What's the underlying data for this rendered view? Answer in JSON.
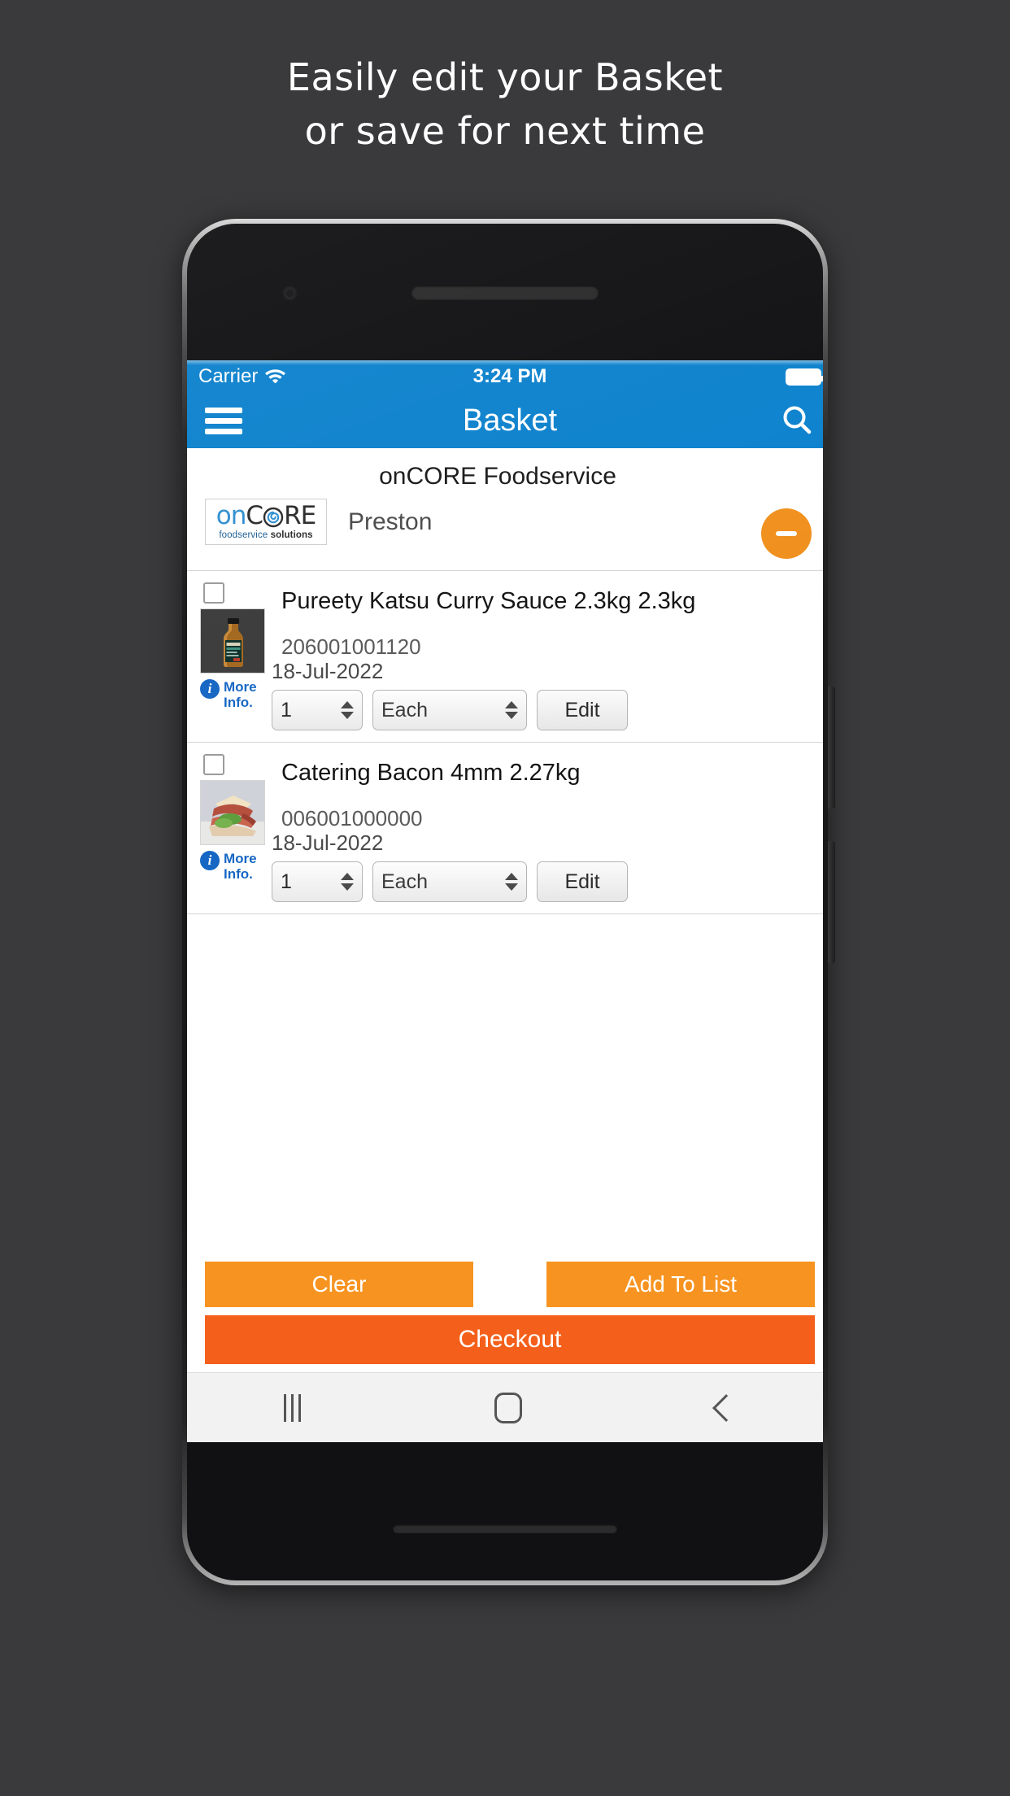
{
  "promo": {
    "headline_line1": "Easily edit your Basket",
    "headline_line2": "or save for next time",
    "background_color": "#3a3a3c",
    "text_color": "#ffffff"
  },
  "status_bar": {
    "carrier": "Carrier",
    "wifi_icon": "wifi-icon",
    "time": "3:24 PM",
    "battery_icon": "battery-full-icon",
    "background_color": "#0d82cd"
  },
  "nav_bar": {
    "menu_icon": "hamburger-menu-icon",
    "title": "Basket",
    "search_icon": "search-icon",
    "background_color": "#0d82cd"
  },
  "supplier": {
    "name": "onCORE Foodservice",
    "branch": "Preston",
    "logo": {
      "word_on": "on",
      "word_core": "C○RE",
      "tagline_food": "foodservice",
      "tagline_solutions": "solutions",
      "on_color": "#2f8fd0",
      "core_color": "#2c2c2c"
    },
    "remove_button": {
      "icon": "minus-icon",
      "color": "#f0911f"
    }
  },
  "products": [
    {
      "checkbox_checked": false,
      "thumbnail_alt": "katsu-curry-sauce-bottle",
      "more_info_label_line1": "More",
      "more_info_label_line2": "Info.",
      "name": "Pureety Katsu Curry Sauce 2.3kg 2.3kg",
      "code": "206001001120",
      "date": "18-Jul-2022",
      "quantity": "1",
      "unit": "Each",
      "edit_label": "Edit"
    },
    {
      "checkbox_checked": false,
      "thumbnail_alt": "catering-bacon-sandwich",
      "more_info_label_line1": "More",
      "more_info_label_line2": "Info.",
      "name": "Catering Bacon 4mm 2.27kg",
      "code": "006001000000",
      "date": "18-Jul-2022",
      "quantity": "1",
      "unit": "Each",
      "edit_label": "Edit"
    }
  ],
  "actions": {
    "clear_label": "Clear",
    "add_to_list_label": "Add To List",
    "checkout_label": "Checkout",
    "secondary_color": "#f79421",
    "primary_color": "#f4601b"
  },
  "android_nav": {
    "recents_icon": "recents-icon",
    "home_icon": "home-icon",
    "back_icon": "back-icon"
  }
}
